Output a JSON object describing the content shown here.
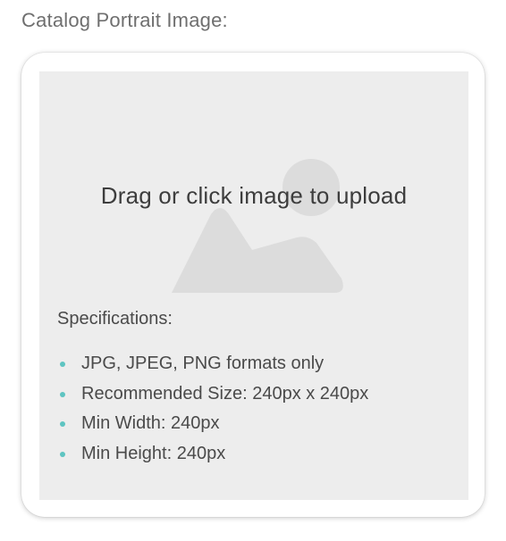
{
  "field_label": "Catalog Portrait Image:",
  "upload": {
    "prompt": "Drag or click image to upload",
    "placeholder_icon": "image-placeholder-icon"
  },
  "specifications": {
    "title": "Specifications:",
    "items": [
      "JPG, JPEG, PNG formats only",
      "Recommended Size: 240px x 240px",
      "Min Width: 240px",
      "Min Height: 240px"
    ]
  },
  "colors": {
    "bullet": "#5ec4c1",
    "dropzone_bg": "#ededed",
    "icon_fill": "#dcdcdc"
  }
}
